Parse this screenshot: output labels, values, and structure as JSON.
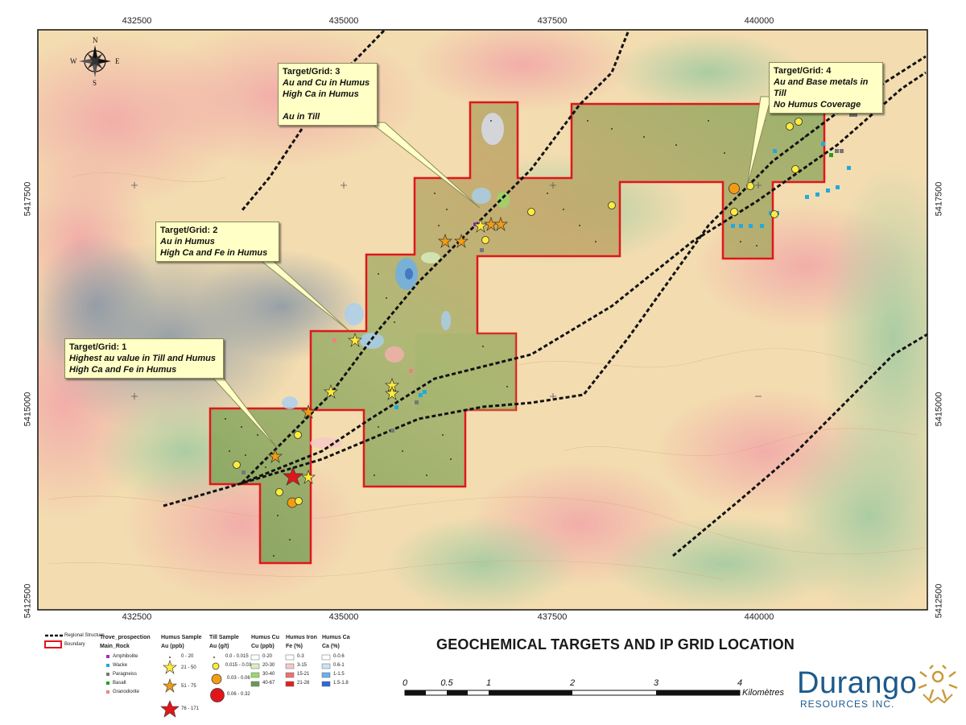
{
  "map": {
    "title": "GEOCHEMICAL TARGETS AND IP GRID LOCATION",
    "easting_ticks": [
      "432500",
      "435000",
      "437500",
      "440000"
    ],
    "northing_ticks": [
      "5417500",
      "5415000",
      "5412500"
    ],
    "compass": {
      "n": "N",
      "s": "S",
      "e": "E",
      "w": "W"
    },
    "colors": {
      "boundary": "#e0161b",
      "structure": "#111111",
      "callout_bg": "#ffffc6"
    }
  },
  "targets": [
    {
      "title": "Target/Grid: 1",
      "lines": [
        "Highest au value in Till and Humus",
        "High Ca and Fe in Humus"
      ]
    },
    {
      "title": "Target/Grid: 2",
      "lines": [
        "Au  in Humus",
        "High Ca and Fe in Humus"
      ]
    },
    {
      "title": "Target/Grid: 3",
      "lines": [
        "Au and Cu in Humus",
        "High Ca in Humus",
        "",
        "Au in Till"
      ]
    },
    {
      "title": "Target/Grid: 4",
      "lines": [
        "Au and Base metals in Till",
        "No Humus Coverage"
      ]
    }
  ],
  "legend": {
    "structure": "Regional Structure",
    "boundary": "Boundary",
    "trove_title": "Trove_prospection",
    "main_rock": "Main_Rock",
    "rocks": [
      {
        "label": "Amphibolite",
        "color": "#9b30c8"
      },
      {
        "label": "Wacke",
        "color": "#22aadd"
      },
      {
        "label": "Paragneiss",
        "color": "#777777"
      },
      {
        "label": "Basalt",
        "color": "#22a022"
      },
      {
        "label": "Granodiorite",
        "color": "#f08080"
      }
    ],
    "humus_sample": {
      "title": "Humus Sample",
      "unit": "Au (ppb)",
      "classes": [
        "0 - 20",
        "21 - 50",
        "51 - 75",
        "76 - 171"
      ]
    },
    "till_sample": {
      "title": "Till Sample",
      "unit": "Au (g/t)",
      "classes": [
        "0.0 - 0.015",
        "0.015 - 0.03",
        "0.03 - 0.06",
        "0.06 - 0.32"
      ]
    },
    "humus_cu": {
      "title": "Humus Cu",
      "unit": "Cu (ppb)",
      "classes": [
        "0-20",
        "20-30",
        "30-40",
        "40-67"
      ],
      "colors": [
        "#ffffff",
        "#d8f0c0",
        "#9ad86a",
        "#6a9a50"
      ]
    },
    "humus_fe": {
      "title": "Humus Iron",
      "unit": "Fe (%)",
      "classes": [
        "0-3",
        "3-15",
        "15-21",
        "21-28"
      ],
      "colors": [
        "#ffffff",
        "#f7c8c8",
        "#ee7070",
        "#e02020"
      ]
    },
    "humus_ca": {
      "title": "Humus Ca",
      "unit": "Ca (%)",
      "classes": [
        "0-0.6",
        "0.6-1",
        "1-1.5",
        "1.5-1.8"
      ],
      "colors": [
        "#ffffff",
        "#c8e4f8",
        "#6ab0ee",
        "#2a6ad8"
      ]
    }
  },
  "scalebar": {
    "labels": [
      "0",
      "0.5",
      "1",
      "2",
      "3",
      "4"
    ],
    "unit": "Kilomètres"
  },
  "logo": {
    "name": "Durango",
    "sub": "RESOURCES INC."
  }
}
